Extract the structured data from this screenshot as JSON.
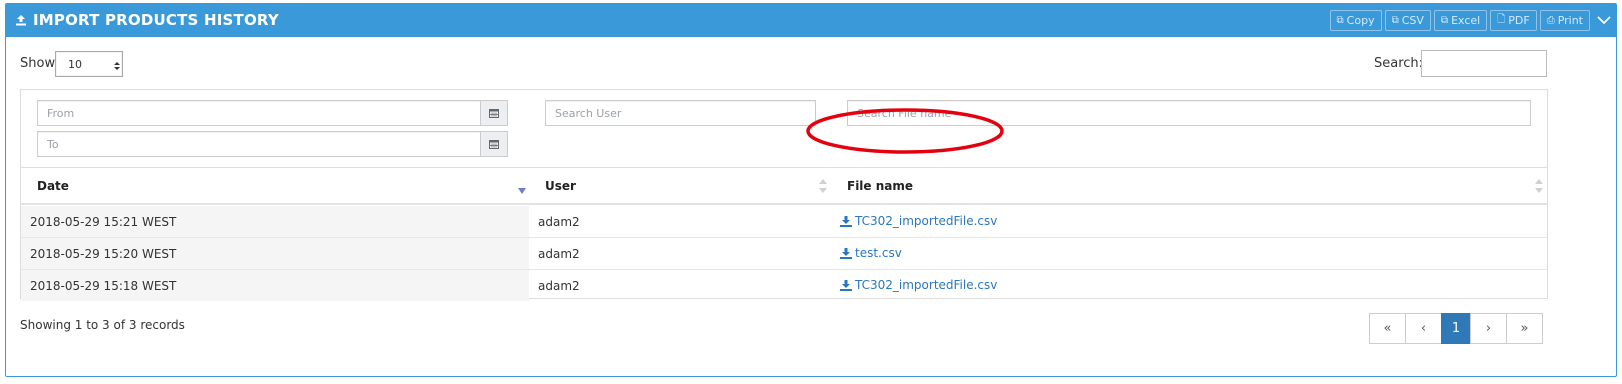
{
  "header": {
    "title": "IMPORT PRODUCTS HISTORY",
    "accent_color": "#3a9ad9",
    "buttons": [
      {
        "label": "Copy",
        "icon": "copy-icon"
      },
      {
        "label": "CSV",
        "icon": "copy-icon"
      },
      {
        "label": "Excel",
        "icon": "copy-icon"
      },
      {
        "label": "PDF",
        "icon": "file-icon"
      },
      {
        "label": "Print",
        "icon": "print-icon"
      }
    ]
  },
  "controls": {
    "show_label": "Show",
    "page_size": "10",
    "search_label": "Search:",
    "search_value": ""
  },
  "filters": {
    "from_placeholder": "From",
    "to_placeholder": "To",
    "user_placeholder": "Search User",
    "file_placeholder": "Search File name"
  },
  "table": {
    "columns": [
      "Date",
      "User",
      "File name"
    ],
    "rows": [
      {
        "date": "2018-05-29 15:21 WEST",
        "user": "adam2",
        "file": "TC302_importedFile.csv"
      },
      {
        "date": "2018-05-29 15:20 WEST",
        "user": "adam2",
        "file": "test.csv"
      },
      {
        "date": "2018-05-29 15:18 WEST",
        "user": "adam2",
        "file": "TC302_importedFile.csv"
      }
    ],
    "highlighted_row": 0
  },
  "footer": {
    "info": "Showing 1 to 3 of 3 records",
    "pages": [
      "«",
      "‹",
      "1",
      "›",
      "»"
    ],
    "current_page": "1"
  }
}
